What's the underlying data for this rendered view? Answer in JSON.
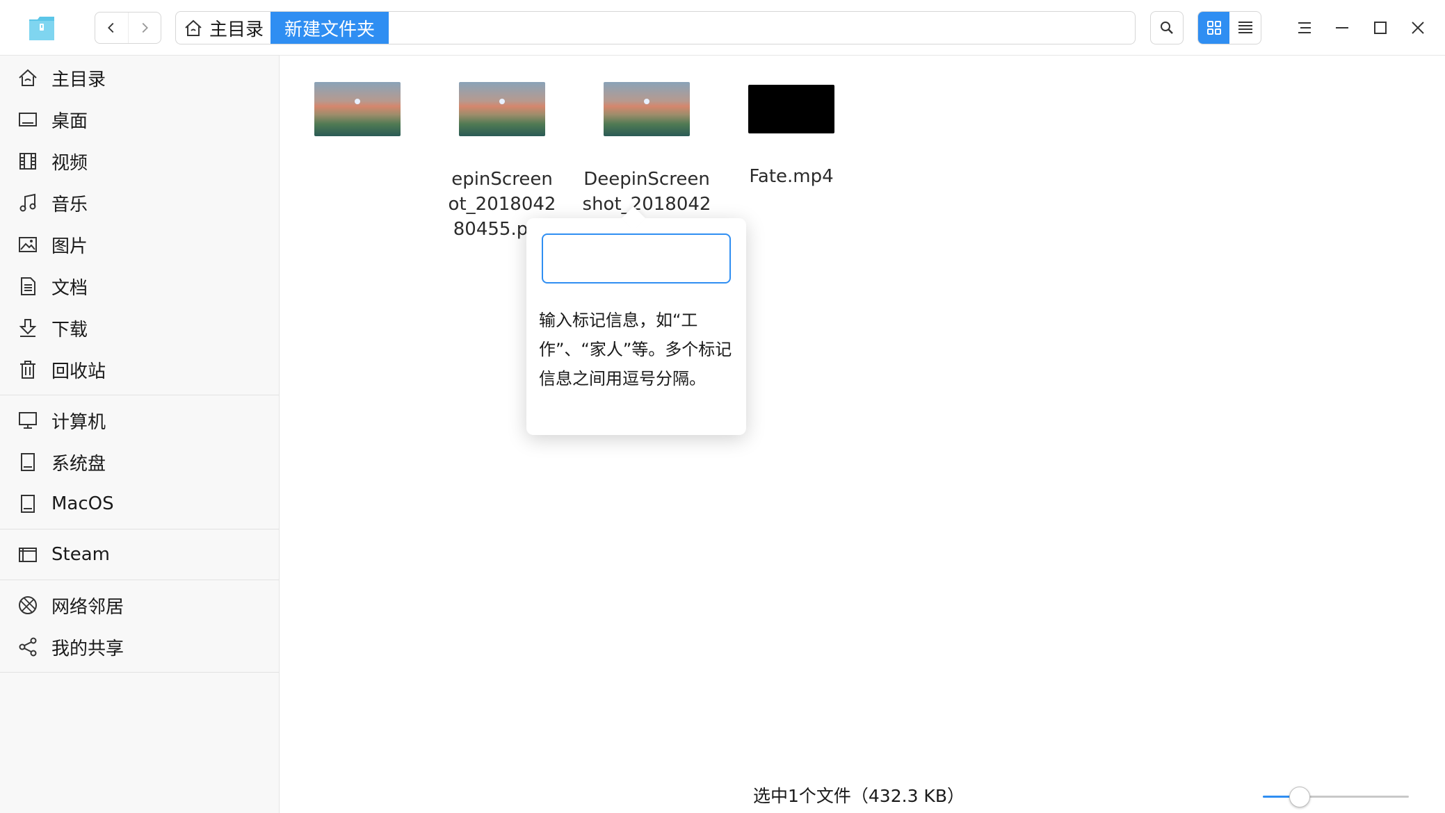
{
  "breadcrumb": {
    "home_label": "主目录",
    "current_folder": "新建文件夹"
  },
  "sidebar": {
    "groups": [
      [
        {
          "label": "主目录",
          "icon": "home-icon"
        },
        {
          "label": "桌面",
          "icon": "desktop-icon"
        },
        {
          "label": "视频",
          "icon": "video-icon"
        },
        {
          "label": "音乐",
          "icon": "music-icon"
        },
        {
          "label": "图片",
          "icon": "picture-icon"
        },
        {
          "label": "文档",
          "icon": "document-icon"
        },
        {
          "label": "下载",
          "icon": "download-icon"
        },
        {
          "label": "回收站",
          "icon": "trash-icon"
        }
      ],
      [
        {
          "label": "计算机",
          "icon": "computer-icon"
        },
        {
          "label": "系统盘",
          "icon": "disk-icon"
        },
        {
          "label": "MacOS",
          "icon": "disk-icon"
        }
      ],
      [
        {
          "label": "Steam",
          "icon": "drive-icon"
        }
      ],
      [
        {
          "label": "网络邻居",
          "icon": "network-icon"
        },
        {
          "label": "我的共享",
          "icon": "share-icon"
        }
      ]
    ]
  },
  "files": [
    {
      "name": "",
      "type": "image"
    },
    {
      "name": "epinScreen\not_2018042\n80455.png",
      "type": "image"
    },
    {
      "name": "DeepinScreen\nshot_2018042\n0080459.png",
      "type": "image"
    },
    {
      "name": "Fate.mp4",
      "type": "video"
    }
  ],
  "tag_popup": {
    "input_value": "",
    "hint": "输入标记信息，如“工作”、“家人”等。多个标记信息之间用逗号分隔。"
  },
  "status": {
    "text": "选中1个文件（432.3 KB）",
    "zoom_fraction": 0.25
  },
  "colors": {
    "accent": "#2f8ef2",
    "sidebar_bg": "#f8f8f8"
  }
}
